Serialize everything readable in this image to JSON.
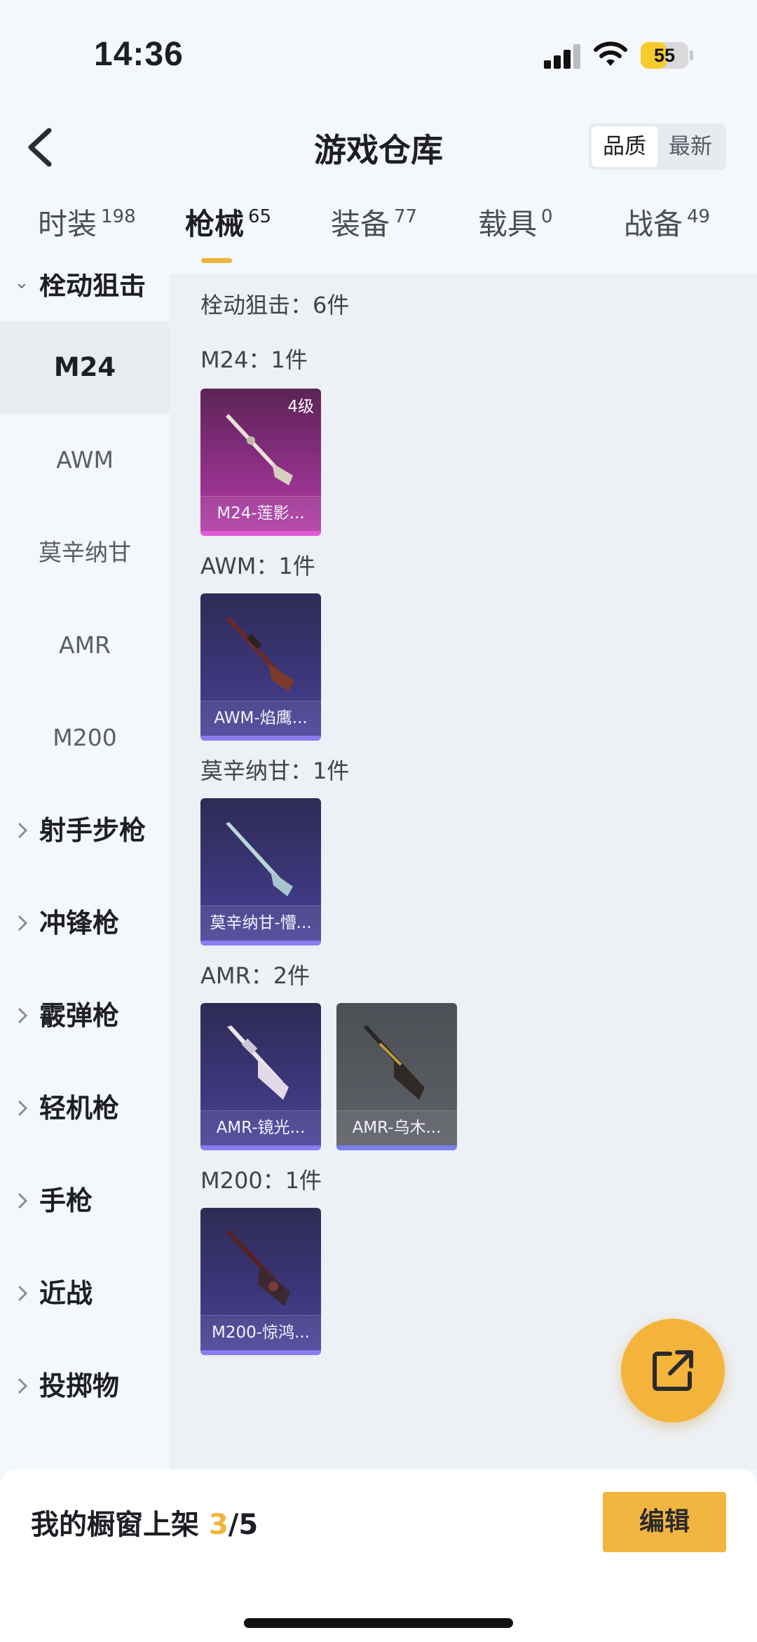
{
  "status": {
    "time": "14:36",
    "battery": "55",
    "battery_level": 0.55
  },
  "header": {
    "title": "游戏仓库",
    "sort_options": [
      "品质",
      "最新"
    ],
    "sort_active": "品质"
  },
  "tabs": [
    {
      "label": "时装",
      "count": "198"
    },
    {
      "label": "枪械",
      "count": "65",
      "active": true
    },
    {
      "label": "装备",
      "count": "77"
    },
    {
      "label": "载具",
      "count": "0"
    },
    {
      "label": "战备",
      "count": "49"
    }
  ],
  "sidebar": {
    "group": "栓动狙击",
    "items": [
      "M24",
      "AWM",
      "莫辛纳甘",
      "AMR",
      "M200"
    ],
    "active": "M24",
    "categories": [
      "射手步枪",
      "冲锋枪",
      "霰弹枪",
      "轻机枪",
      "手枪",
      "近战",
      "投掷物"
    ]
  },
  "content": {
    "header": "栓动狙击：6件",
    "sections": [
      {
        "title": "M24：1件",
        "items": [
          {
            "name": "M24-莲影...",
            "level": "4级",
            "rarity": "magenta"
          }
        ]
      },
      {
        "title": "AWM：1件",
        "items": [
          {
            "name": "AWM-焰鹰...",
            "rarity": "purple"
          }
        ]
      },
      {
        "title": "莫辛纳甘：1件",
        "items": [
          {
            "name": "莫辛纳甘-懵...",
            "rarity": "purple"
          }
        ]
      },
      {
        "title": "AMR：2件",
        "items": [
          {
            "name": "AMR-镜光...",
            "rarity": "purple"
          },
          {
            "name": "AMR-乌木...",
            "rarity": "gray"
          }
        ]
      },
      {
        "title": "M200：1件",
        "items": [
          {
            "name": "M200-惊鸿...",
            "rarity": "purple"
          }
        ]
      }
    ]
  },
  "bottom": {
    "showcase_label": "我的橱窗上架",
    "showcase_current": "3",
    "showcase_total": "/5",
    "edit_label": "编辑"
  },
  "colors": {
    "accent": "#f1b43a",
    "magenta_card": "#8e2f86",
    "purple_card": "#3b3679"
  },
  "icons": [
    "back-icon",
    "share-icon",
    "signal-icon",
    "wifi-icon",
    "battery-icon",
    "chevron-right-icon",
    "caret-down-icon"
  ]
}
